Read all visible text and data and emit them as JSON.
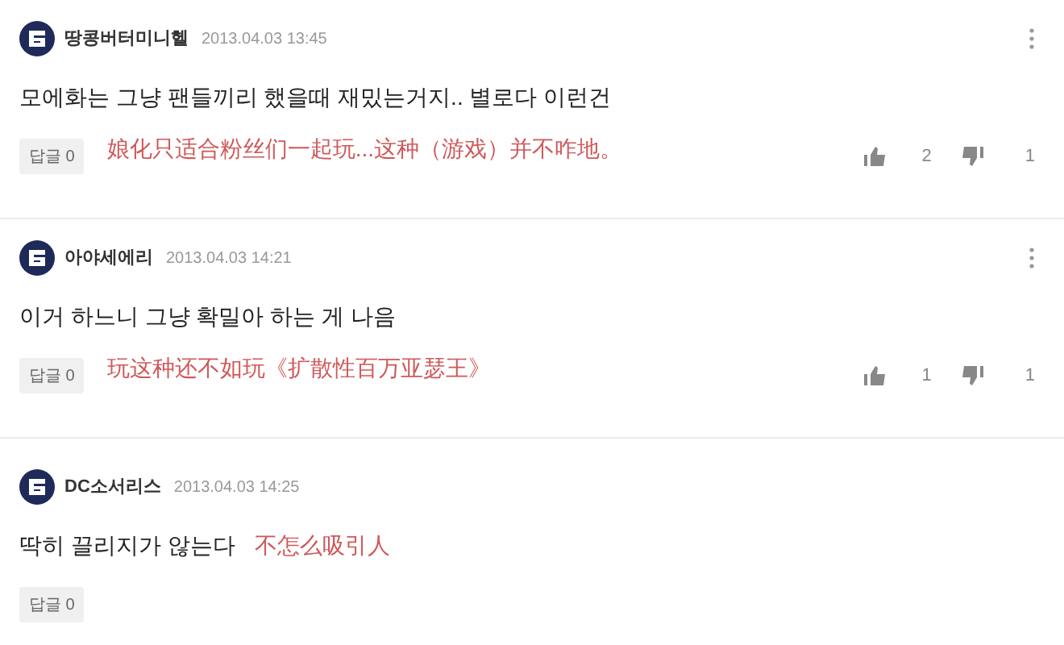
{
  "comments": [
    {
      "author": "땅콩버터미니헬",
      "time": "2013.04.03 13:45",
      "text": "모에화는 그냥 팬들끼리 했을때 재밌는거지.. 별로다 이런건",
      "note": {
        "kind": "below",
        "text": "娘化只适合粉丝们一起玩...这种（游戏）并不咋地。"
      },
      "reply": "답글 0",
      "likes": "2",
      "dislikes": "1",
      "menu": true
    },
    {
      "author": "아야세에리",
      "time": "2013.04.03 14:21",
      "text": "이거 하느니 그냥 확밀아 하는 게 나음",
      "note": {
        "kind": "below",
        "text": "玩这种还不如玩《扩散性百万亚瑟王》"
      },
      "reply": "답글 0",
      "likes": "1",
      "dislikes": "1",
      "menu": true
    },
    {
      "author": "DC소서리스",
      "time": "2013.04.03 14:25",
      "text": "딱히 끌리지가 않는다",
      "note": {
        "kind": "inline",
        "text": "不怎么吸引人"
      },
      "reply": "답글 0",
      "menu": false
    }
  ]
}
